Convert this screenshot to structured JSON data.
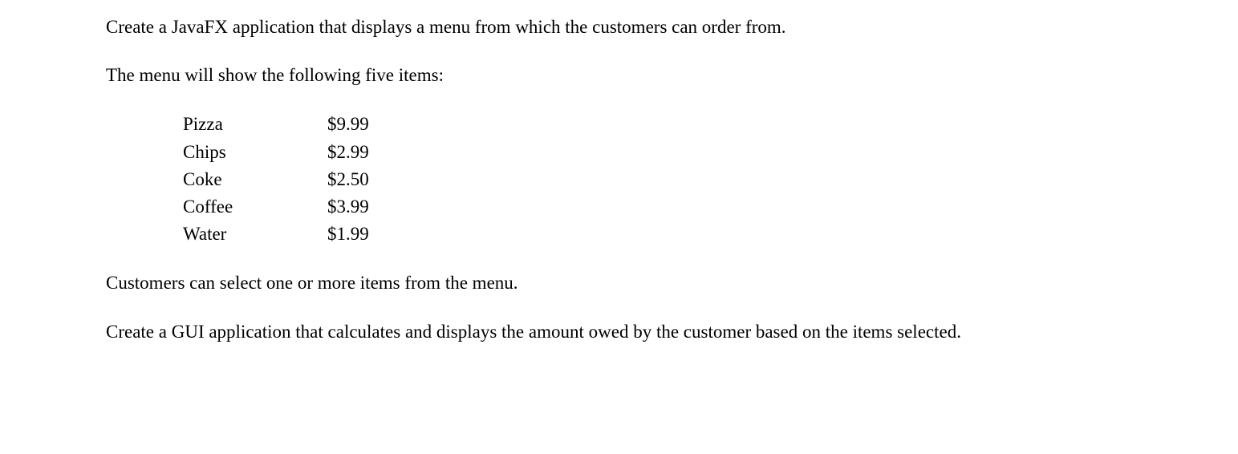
{
  "paragraphs": {
    "intro": "Create a JavaFX application that displays a menu from which the customers can order from.",
    "menu_lead": "The menu will show the following five items:",
    "selection": "Customers can select one or more items from the menu.",
    "task": "Create a GUI application that calculates and displays the amount owed by the customer based on the items selected."
  },
  "menu_items": [
    {
      "name": "Pizza",
      "price": "$9.99"
    },
    {
      "name": "Chips",
      "price": "$2.99"
    },
    {
      "name": "Coke",
      "price": "$2.50"
    },
    {
      "name": "Coffee",
      "price": "$3.99"
    },
    {
      "name": "Water",
      "price": "$1.99"
    }
  ]
}
